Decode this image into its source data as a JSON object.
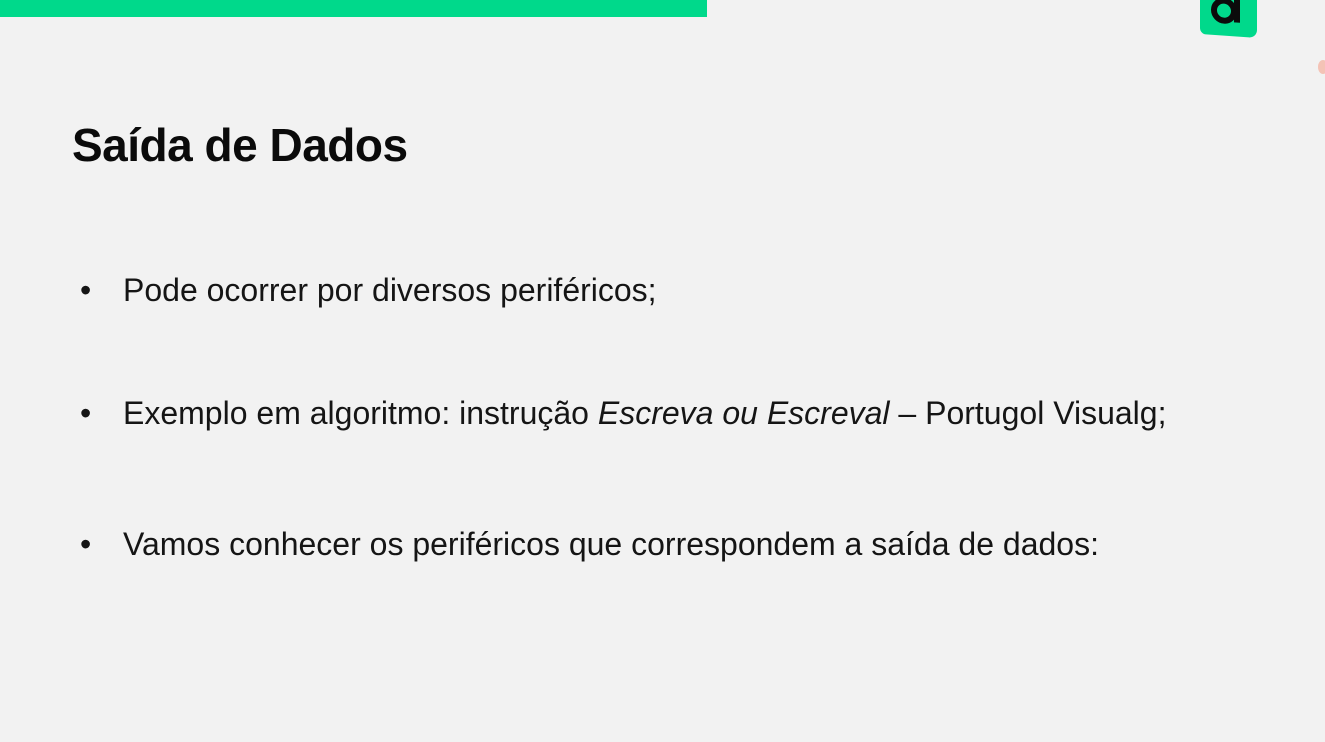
{
  "slide": {
    "title": "Saída de Dados",
    "bullet_symbol": "•",
    "bullets": [
      {
        "text": "Pode ocorrer por diversos periféricos;"
      },
      {
        "prefix": "Exemplo em algoritmo: instrução ",
        "emphasis": "Escreva ou Escreval",
        "suffix": " – Portugol Visualg;"
      },
      {
        "text": "Vamos conhecer os periféricos que correspondem a saída de dados:"
      }
    ]
  },
  "brand": {
    "accent_color": "#00d98b",
    "logo_icon": "letter-d-logo-icon"
  }
}
